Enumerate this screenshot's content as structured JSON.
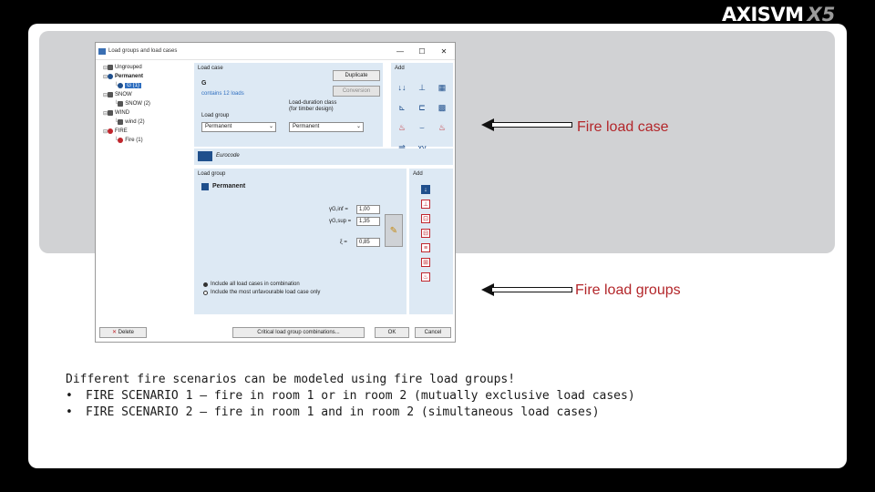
{
  "logo": {
    "main": "AXISVM",
    "version": "X5"
  },
  "dialog": {
    "title": "Load groups and load cases",
    "close_glyph": "✕",
    "tree": [
      {
        "label": "Ungrouped",
        "indent": 0,
        "icon": "gray"
      },
      {
        "label": "Permanent",
        "indent": 0,
        "icon": "blue",
        "bold": true
      },
      {
        "label": "G (1)",
        "indent": 1,
        "icon": "blue",
        "selected": true
      },
      {
        "label": "SNOW",
        "indent": 0,
        "icon": "gray"
      },
      {
        "label": "SNOW (2)",
        "indent": 1,
        "icon": "gray"
      },
      {
        "label": "WIND",
        "indent": 0,
        "icon": "gray"
      },
      {
        "label": "wind (2)",
        "indent": 1,
        "icon": "gray"
      },
      {
        "label": "FIRE",
        "indent": 0,
        "icon": "red"
      },
      {
        "label": "Fire (1)",
        "indent": 1,
        "icon": "red"
      }
    ],
    "load_case": {
      "title": "Load case",
      "name": "G",
      "contains": "contains 12 loads",
      "duplicate_label": "Duplicate",
      "conversion_label": "Conversion",
      "load_group_label": "Load group",
      "load_group_value": "Permanent",
      "duration_label_1": "Load-duration class",
      "duration_label_2": "(for timber design)",
      "duration_value": "Permanent"
    },
    "add_title": "Add",
    "code": {
      "label": "Eurocode"
    },
    "load_group": {
      "title": "Load group",
      "name": "Permanent",
      "gamma_inf_label": "γG,inf =",
      "gamma_inf_value": "1,00",
      "gamma_sup_label": "γG,sup =",
      "gamma_sup_value": "1,35",
      "xi_label": "ξ =",
      "xi_value": "0,85",
      "radio_1": "Include all load cases in combination",
      "radio_2": "Include the most unfavourable load case only"
    },
    "add2_title": "Add",
    "buttons": {
      "delete": "Delete",
      "critical": "Critical load group combinations...",
      "ok": "OK",
      "cancel": "Cancel"
    }
  },
  "annotations": {
    "fire_load_case": "Fire load case",
    "fire_load_groups": "Fire load groups"
  },
  "text": {
    "intro": "Different fire scenarios can be modeled using fire load groups!",
    "bullet_1": "FIRE SCENARIO 1 – fire in room 1 or in room 2 (mutually exclusive load cases)",
    "bullet_2": "FIRE SCENARIO 2 – fire in room 1 and in room 2 (simultaneous load cases)",
    "bullet_glyph": "•"
  }
}
